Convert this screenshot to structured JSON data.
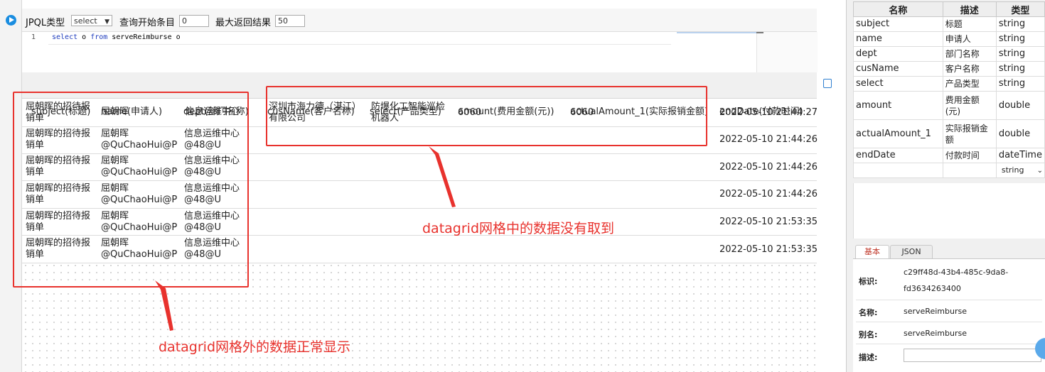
{
  "toolbar": {
    "jpql_type_label": "JPQL类型",
    "jpql_type_value": "select",
    "start_label": "查询开始条目",
    "start_value": "0",
    "max_label": "最大返回结果",
    "max_value": "50"
  },
  "editor": {
    "line_number": "1",
    "kw_select": "select",
    "var_o": " o ",
    "kw_from": "from",
    "entity": " serveReimburse o"
  },
  "grid": {
    "headers": {
      "subject": "subject(标题)",
      "name": "name(申请人)",
      "dept": "dept(部门名称)",
      "cusName": "cusName(客户名称)",
      "select": "select(产品类型)",
      "amount": "amount(费用金额(元))",
      "actualAmount": "actualAmount_1(实际报销金额)",
      "endDate": "endDate(付款时间)"
    },
    "overlay_row": {
      "subject": [
        "屈朝晖的招待报",
        "销单"
      ],
      "name": "屈朝晖",
      "dept": "信息运维中心",
      "cusName": [
        "深圳市海力德（湛江）",
        "有限公司"
      ],
      "select": [
        "防爆化工智能巡检",
        "机器人"
      ],
      "amount": "6060",
      "actualAmount": "6060",
      "endDate": "2022-05-10 21:44:27"
    },
    "rows": [
      {
        "subject": [
          "屈朝晖的招待报",
          "销单"
        ],
        "name": [
          "屈朝晖",
          "@QuChaoHui@P"
        ],
        "dept": [
          "信息运维中心",
          "@48@U"
        ],
        "endDate": "2022-05-10 21:44:26"
      },
      {
        "subject": [
          "屈朝晖的招待报",
          "销单"
        ],
        "name": [
          "屈朝晖",
          "@QuChaoHui@P"
        ],
        "dept": [
          "信息运维中心",
          "@48@U"
        ],
        "endDate": "2022-05-10 21:44:26"
      },
      {
        "subject": [
          "屈朝晖的招待报",
          "销单"
        ],
        "name": [
          "屈朝晖",
          "@QuChaoHui@P"
        ],
        "dept": [
          "信息运维中心",
          "@48@U"
        ],
        "endDate": "2022-05-10 21:44:26"
      },
      {
        "subject": [
          "屈朝晖的招待报",
          "销单"
        ],
        "name": [
          "屈朝晖",
          "@QuChaoHui@P"
        ],
        "dept": [
          "信息运维中心",
          "@48@U"
        ],
        "endDate": "2022-05-10 21:53:35"
      },
      {
        "subject": [
          "屈朝晖的招待报",
          "销单"
        ],
        "name": [
          "屈朝晖",
          "@QuChaoHui@P"
        ],
        "dept": [
          "信息运维中心",
          "@48@U"
        ],
        "endDate": "2022-05-10 21:53:35"
      }
    ]
  },
  "props": {
    "headers": [
      "名称",
      "描述",
      "类型"
    ],
    "rows": [
      {
        "name": "subject",
        "desc": "标题",
        "type": "string"
      },
      {
        "name": "name",
        "desc": "申请人",
        "type": "string"
      },
      {
        "name": "dept",
        "desc": "部门名称",
        "type": "string"
      },
      {
        "name": "cusName",
        "desc": "客户名称",
        "type": "string"
      },
      {
        "name": "select",
        "desc": "产品类型",
        "type": "string"
      },
      {
        "name": "amount",
        "desc": "费用金额(元)",
        "type": "double"
      },
      {
        "name": "actualAmount_1",
        "desc": "实际报销金额",
        "type": "double"
      },
      {
        "name": "endDate",
        "desc": "付款时间",
        "type": "dateTime"
      }
    ],
    "new_type_value": "string"
  },
  "tabs": {
    "basic": "基本",
    "json": "JSON"
  },
  "form": {
    "id_label": "标识:",
    "id_value_1": "c29ff48d-43b4-485c-9da8-",
    "id_value_2": "fd3634263400",
    "name_label": "名称:",
    "name_value": "serveReimburse",
    "alias_label": "别名:",
    "alias_value": "serveReimburse",
    "desc_label": "描述:"
  },
  "annotations": {
    "inside": "datagrid网格中的数据没有取到",
    "outside": "datagrid网格外的数据正常显示"
  },
  "colors": {
    "annotation_red": "#e8322d",
    "accent_blue": "#1a8de0"
  }
}
